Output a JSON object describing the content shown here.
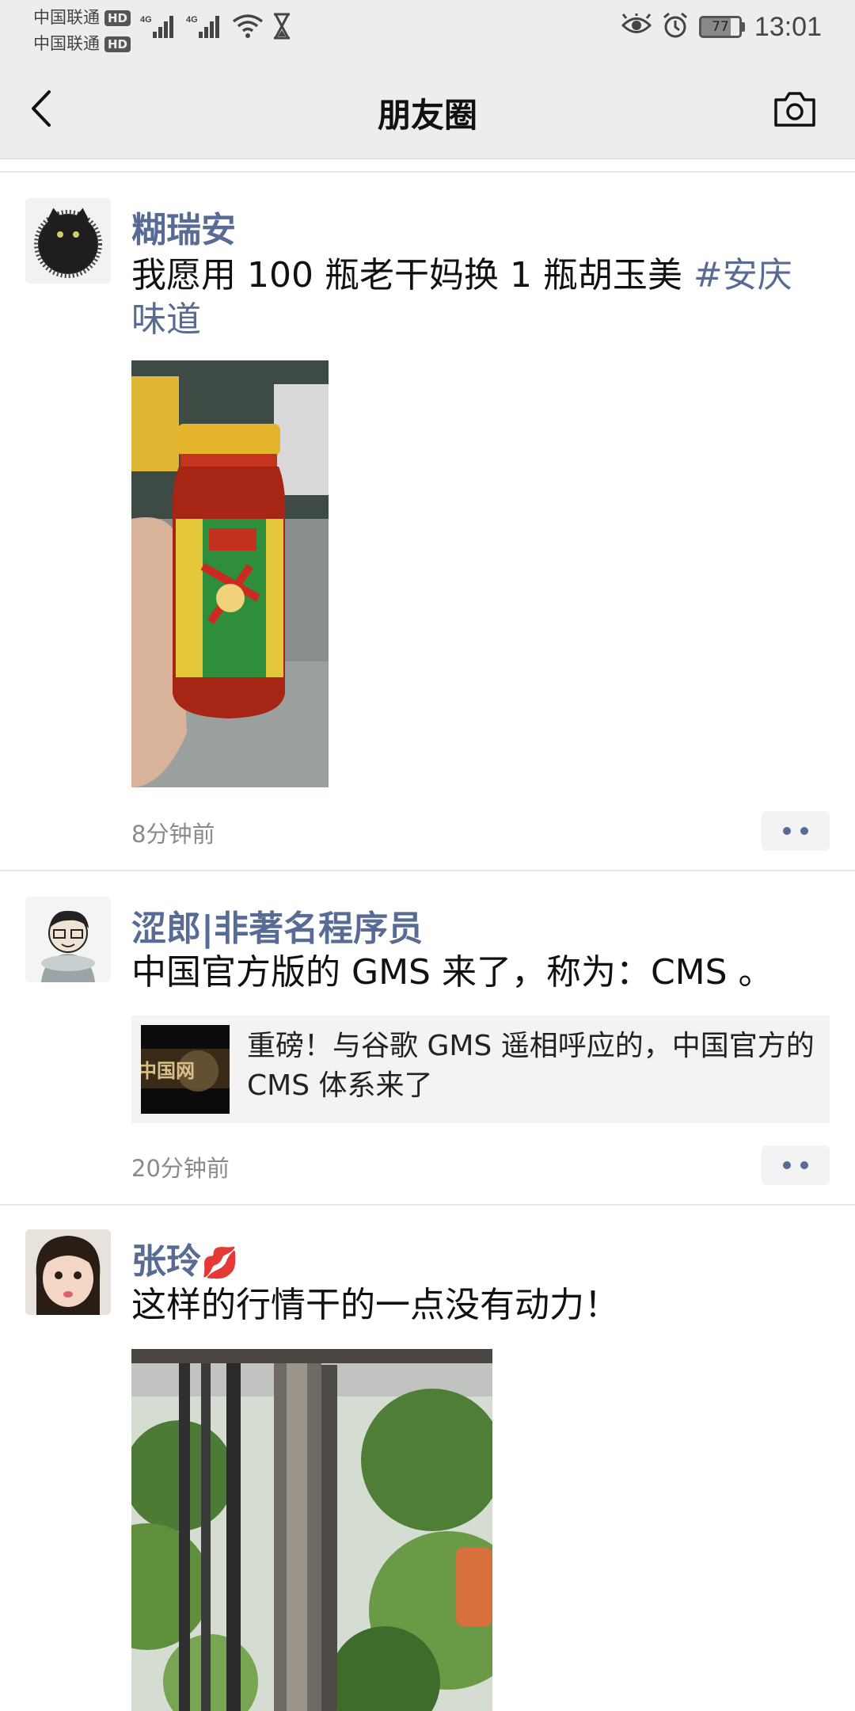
{
  "status_bar": {
    "carrier_1": "中国联通",
    "carrier_2": "中国联通",
    "hd_1": "HD",
    "hd_2": "HD",
    "network_1": "4G",
    "network_2": "4G",
    "battery": "77",
    "time": "13:01",
    "icons": [
      "signal-icon",
      "wifi-icon",
      "hourglass-icon",
      "eye-icon",
      "alarm-icon",
      "battery-icon"
    ]
  },
  "nav": {
    "title": "朋友圈",
    "back_icon": "chevron-left-icon",
    "camera_icon": "camera-icon"
  },
  "posts": [
    {
      "username": "糊瑞安",
      "text": "我愿用 100 瓶老干妈换 1 瓶胡玉美 ",
      "hashtag": "#安庆味道",
      "time": "8分钟前"
    },
    {
      "username": "涩郎|非著名程序员",
      "text": "中国官方版的 GMS 来了，称为：CMS 。",
      "link_title": "重磅！与谷歌 GMS 遥相呼应的，中国官方的 CMS 体系来了",
      "link_thumb_text": "中国网",
      "time": "20分钟前"
    },
    {
      "username": "张玲",
      "username_emoji": "💋",
      "text": "这样的行情干的一点没有动力！"
    }
  ],
  "colors": {
    "link_blue": "#576b95",
    "bar_gray": "#ededed",
    "time_gray": "#8a8a8a"
  }
}
